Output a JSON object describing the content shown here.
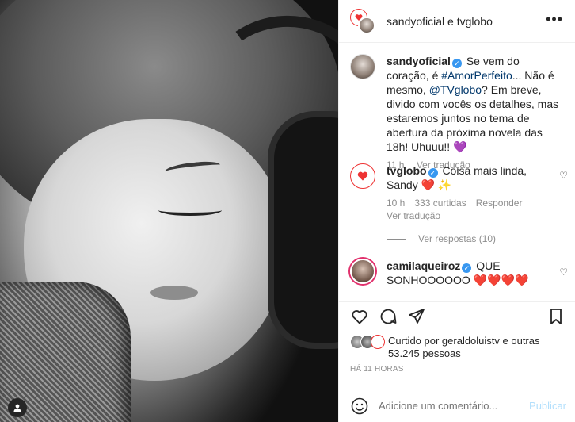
{
  "header": {
    "title": "sandyoficial e tvglobo"
  },
  "caption": {
    "user": "sandyoficial",
    "text_1": "Se vem do coração, é ",
    "hashtag": "#AmorPerfeito",
    "text_2": "... Não é mesmo, ",
    "mention": "@TVglobo",
    "text_3": "? Em breve, divido com vocês os detalhes, mas estaremos juntos no tema de abertura da próxima novela das 18h! Uhuuu!! 💜",
    "time": "11 h",
    "translate": "Ver tradução"
  },
  "comments": [
    {
      "user": "tvglobo",
      "text": "Coisa mais linda, Sandy ❤️ ✨",
      "time": "10 h",
      "likes": "333 curtidas",
      "reply": "Responder",
      "translate": "Ver tradução",
      "view_replies": "Ver respostas (10)"
    },
    {
      "user": "camilaqueiroz",
      "text": "QUE SONHOOOOOO ❤️❤️❤️❤️"
    }
  ],
  "likes_text": "Curtido por geraldoluistv e outras 53.245 pessoas",
  "posted_time": "HÁ 11 HORAS",
  "add_comment": {
    "placeholder": "Adicione um comentário...",
    "post_label": "Publicar"
  },
  "icons": {
    "like": "heart-icon",
    "comment": "comment-icon",
    "share": "share-icon",
    "save": "bookmark-icon",
    "more": "more-icon",
    "emoji": "emoji-icon"
  },
  "colors": {
    "link": "#00376b",
    "verified": "#3897f0",
    "muted": "#8e8e8e",
    "heart": "#ed4956"
  }
}
